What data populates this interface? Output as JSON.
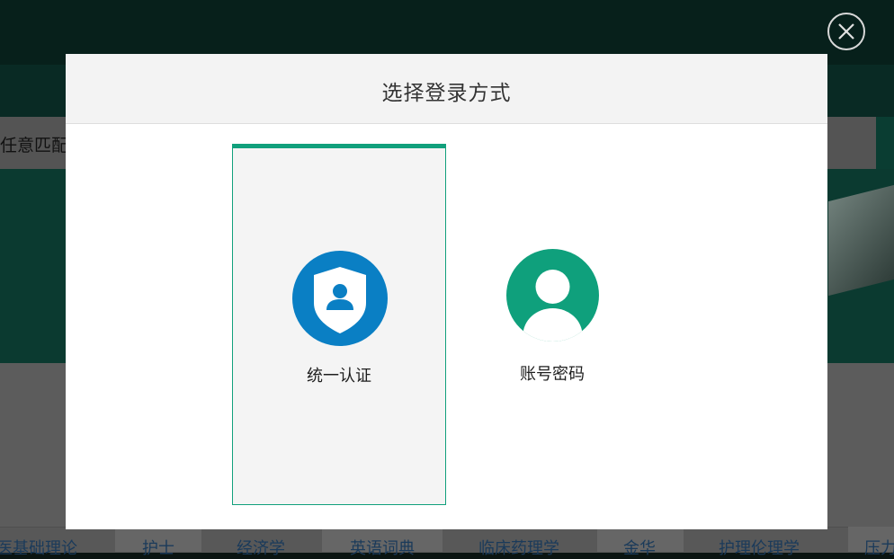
{
  "background": {
    "search_text": "任意匹配",
    "tabs": [
      "医基础理论",
      "护士",
      "经济学",
      "英语词典",
      "临床药理学",
      "金华",
      "护理伦理学",
      "压力"
    ]
  },
  "modal": {
    "title": "选择登录方式",
    "options": [
      {
        "label": "统一认证",
        "icon": "shield-user-icon",
        "color": "#0a7fc4",
        "selected": true
      },
      {
        "label": "账号密码",
        "icon": "user-avatar-icon",
        "color": "#0fa07c",
        "selected": false
      }
    ]
  },
  "colors": {
    "accent": "#11a07c",
    "selected_bg": "#f4f4f4"
  }
}
